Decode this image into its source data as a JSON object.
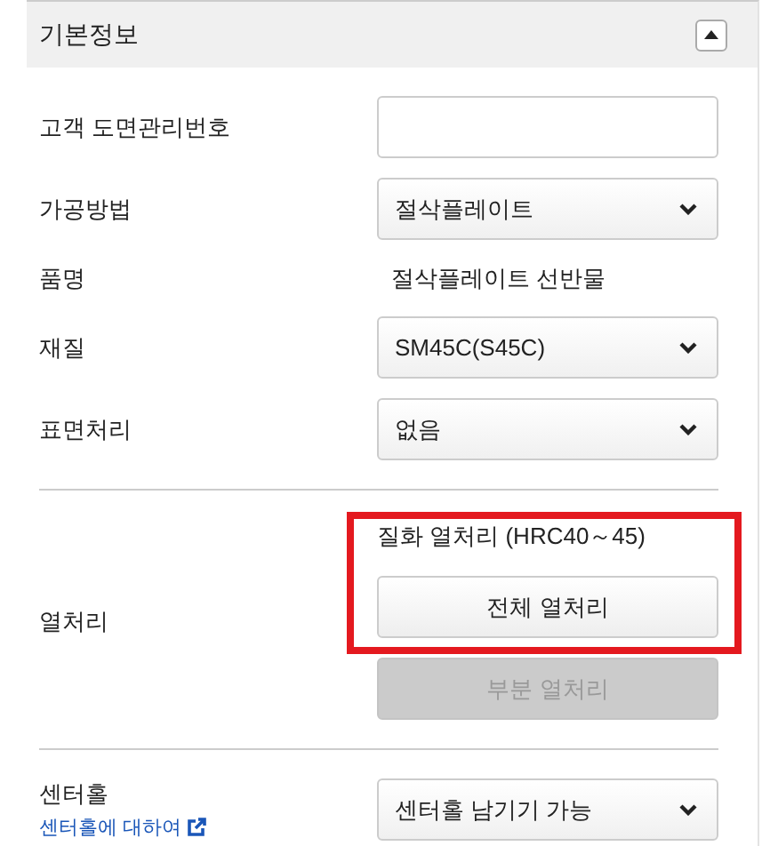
{
  "section": {
    "title": "기본정보",
    "expanded": true
  },
  "groups": [
    {
      "rows": [
        {
          "kind": "input",
          "label": "고객 도면관리번호"
        },
        {
          "kind": "select",
          "label": "가공방법",
          "value": "절삭플레이트"
        },
        {
          "kind": "text",
          "label": "품명",
          "value": "절삭플레이트 선반물"
        },
        {
          "kind": "select",
          "label": "재질",
          "value": "SM45C(S45C)"
        },
        {
          "kind": "select",
          "label": "표면처리",
          "value": "없음"
        }
      ]
    },
    {
      "rows": [
        {
          "kind": "actions",
          "label": "열처리",
          "items": [
            {
              "kind": "note",
              "text": "질화 열처리 (HRC40～45)",
              "highlighted": true
            },
            {
              "kind": "button",
              "text": "전체 열처리",
              "disabled": false,
              "highlighted": true
            },
            {
              "kind": "button",
              "text": "부분 열처리",
              "disabled": true,
              "highlighted": false
            }
          ]
        }
      ]
    },
    {
      "rows": [
        {
          "kind": "select",
          "label": "센터홀",
          "link": "센터홀에 대하여",
          "value": "센터홀 남기기 가능"
        }
      ]
    }
  ]
}
